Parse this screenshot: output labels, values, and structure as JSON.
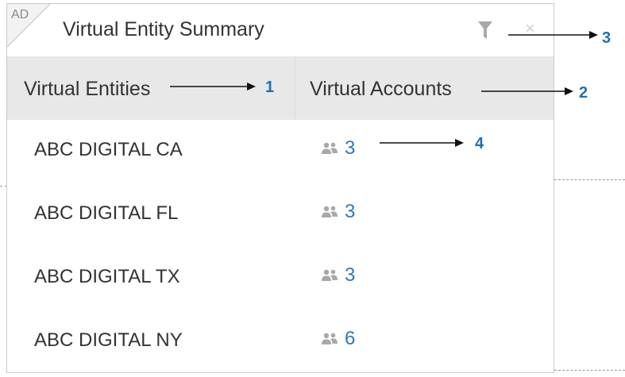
{
  "widget": {
    "corner_label": "AD",
    "title": "Virtual Entity Summary",
    "filter_icon": "filter-icon",
    "close_icon": "close-icon",
    "close_glyph": "×"
  },
  "table": {
    "headers": [
      "Virtual Entities",
      "Virtual Accounts"
    ],
    "rows": [
      {
        "entity": "ABC DIGITAL CA",
        "accounts": "3"
      },
      {
        "entity": "ABC DIGITAL FL",
        "accounts": "3"
      },
      {
        "entity": "ABC DIGITAL TX",
        "accounts": "3"
      },
      {
        "entity": "ABC DIGITAL NY",
        "accounts": "6"
      }
    ],
    "accounts_icon": "users-icon"
  },
  "annotations": {
    "one": "1",
    "two": "2",
    "three": "3",
    "four": "4"
  },
  "colors": {
    "link": "#2f78b8",
    "annotation": "#1f6fb2",
    "header_bg": "#e8e8e8",
    "icon_gray": "#a8a8a8"
  }
}
